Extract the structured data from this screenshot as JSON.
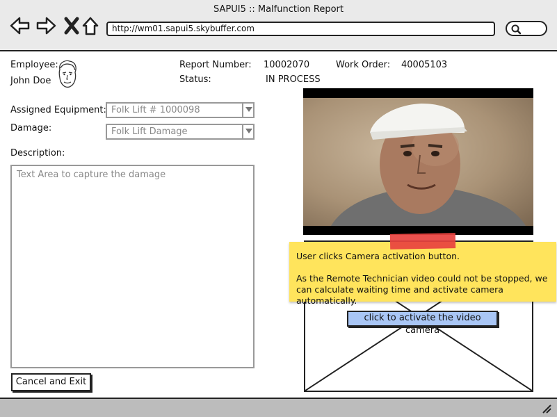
{
  "window": {
    "title": "SAPUI5 :: Malfunction Report",
    "url": "http://wm01.sapui5.skybuffer.com"
  },
  "header": {
    "employee_label": "Employee:",
    "employee_name": "John Doe",
    "report_number_label": "Report Number:",
    "report_number": "10002070",
    "work_order_label": "Work Order:",
    "work_order": "40005103",
    "status_label": "Status:",
    "status": "IN PROCESS"
  },
  "form": {
    "equipment_label": "Assigned Equipment:",
    "equipment_value": "Folk Lift # 1000098",
    "damage_label": "Damage:",
    "damage_value": "Folk Lift Damage",
    "description_label": "Description:",
    "description_placeholder": "Text Area to capture the damage"
  },
  "buttons": {
    "cancel": "Cancel and Exit",
    "activate_camera": "click to activate the video camera"
  },
  "note": {
    "line1": "User clicks Camera activation button.",
    "line2": "As the Remote Technician video could not be stopped, we can calculate waiting time and activate camera automatically."
  },
  "colors": {
    "note": "#ffe45c",
    "tape": "#e8423f",
    "camera_button": "#a9c6f5"
  }
}
